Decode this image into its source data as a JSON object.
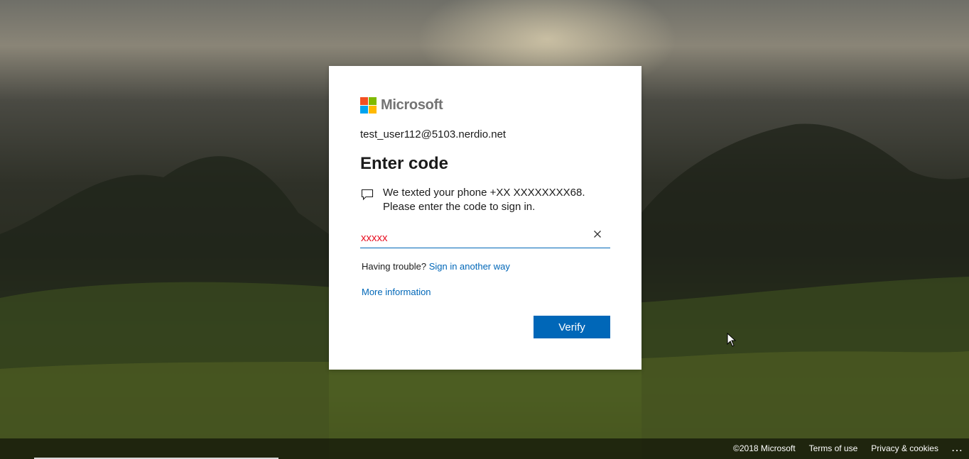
{
  "brand": {
    "name": "Microsoft",
    "colors": [
      "#f25022",
      "#7fba00",
      "#00a4ef",
      "#ffb900"
    ]
  },
  "card": {
    "identity": "test_user112@5103.nerdio.net",
    "title": "Enter code",
    "message_icon": "chat-bubble-icon",
    "message": "We texted your phone +XX XXXXXXXX68. Please enter the code to sign in.",
    "code_value": "xxxxx",
    "code_placeholder": "Code",
    "clear_icon": "close-icon",
    "trouble_text": "Having trouble?",
    "sign_in_another_way": "Sign in another way",
    "more_information": "More information",
    "verify_label": "Verify"
  },
  "footer": {
    "copyright": "©2018 Microsoft",
    "terms": "Terms of use",
    "privacy": "Privacy & cookies",
    "more": "..."
  },
  "colors": {
    "accent": "#0067b8",
    "error_text": "#e81123"
  }
}
